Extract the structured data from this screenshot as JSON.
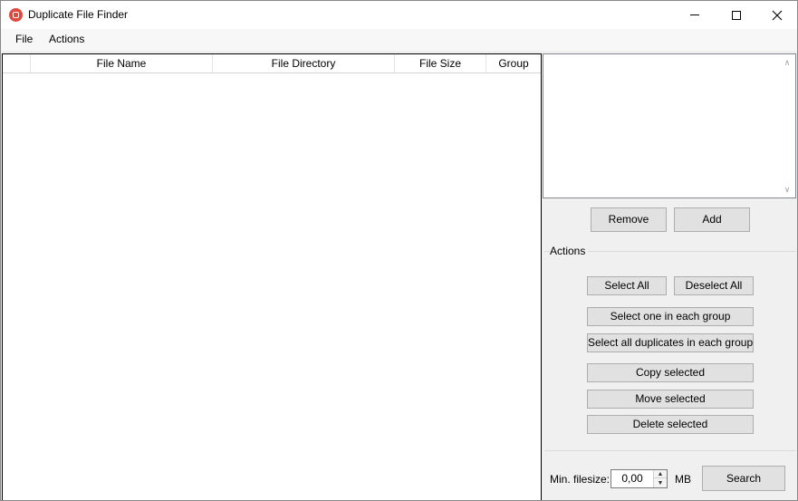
{
  "window": {
    "title": "Duplicate File Finder",
    "controls": [
      "minimize-icon",
      "maximize-icon",
      "close-icon"
    ]
  },
  "menu": {
    "items": [
      "File",
      "Actions"
    ]
  },
  "file_list": {
    "columns": [
      "",
      "File Name",
      "File Directory",
      "File Size",
      "Group"
    ],
    "rows": []
  },
  "directories": {
    "items": [],
    "remove_label": "Remove",
    "add_label": "Add"
  },
  "actions": {
    "group_label": "Actions",
    "select_all": "Select All",
    "deselect_all": "Deselect All",
    "select_one": "Select one in each group",
    "select_all_dups": "Select all duplicates in each group",
    "copy_selected": "Copy selected",
    "move_selected": "Move selected",
    "delete_selected": "Delete  selected"
  },
  "search": {
    "min_filesize_label": "Min. filesize:",
    "min_filesize_value": "0,00",
    "unit": "MB",
    "search_label": "Search"
  }
}
